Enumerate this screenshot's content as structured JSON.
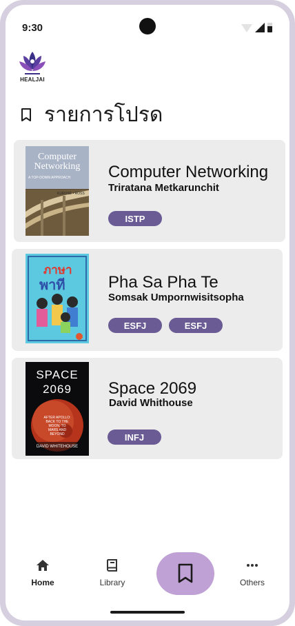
{
  "status_bar": {
    "time": "9:30"
  },
  "logo": {
    "text": "HEALJAI",
    "icon": "lotus-logo-icon"
  },
  "header": {
    "title": "รายการโปรด",
    "icon": "bookmark-outline-icon"
  },
  "favorites": [
    {
      "title": "Computer Networking",
      "author": "Triratana Metkarunchit",
      "tags": [
        "ISTP"
      ],
      "cover": {
        "title_line1": "Computer",
        "title_line2": "Networking",
        "subtitle": "A TOP-DOWN APPROACH",
        "authors": "KUROSE • ROSS"
      }
    },
    {
      "title": "Pha Sa Pha Te",
      "author": "Somsak Umpornwisitsopha",
      "tags": [
        "ESFJ",
        "ESFJ"
      ],
      "cover": {
        "title_line1": "ภาษา",
        "title_line2": "พาที"
      }
    },
    {
      "title": "Space 2069",
      "author": "David Whithouse",
      "tags": [
        "INFJ"
      ],
      "cover": {
        "title_line1": "SPACE",
        "title_line2": "2069",
        "subtitle": "AFTER APOLLO: BACK TO THE MOON, TO MARS AND BEYOND",
        "authors": "DAVID WHITEHOUSE"
      }
    }
  ],
  "bottom_nav": {
    "items": [
      {
        "label": "Home",
        "icon": "home-icon",
        "active": true
      },
      {
        "label": "Library",
        "icon": "book-icon",
        "active": false
      },
      {
        "label": "",
        "icon": "bookmark-icon",
        "active": false
      },
      {
        "label": "Others",
        "icon": "more-horiz-icon",
        "active": false
      }
    ]
  },
  "colors": {
    "accent": "#6a5b95",
    "fab": "#c0a1d6",
    "card": "#ececec",
    "frame": "#d6cfdf"
  }
}
